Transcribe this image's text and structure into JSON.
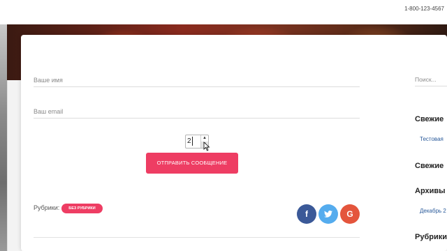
{
  "header": {
    "phone": "1-800-123-4567"
  },
  "form": {
    "name_placeholder": "Ваше имя",
    "email_placeholder": "Ваш email",
    "spinner_value": "2",
    "submit_label": "ОТПРАВИТЬ СООБЩЕНИЕ"
  },
  "post_meta": {
    "categories_label": "Рубрики:",
    "category_badge": "БЕЗ РУБРИКИ"
  },
  "social": {
    "facebook": "f",
    "twitter": "t",
    "google": "G"
  },
  "sidebar": {
    "search_placeholder": "Поиск...",
    "headings": [
      "Свежие",
      "Свежие",
      "Архивы",
      "Рубрики"
    ],
    "links": [
      "Тестовая",
      "Декабрь 2"
    ]
  },
  "colors": {
    "accent": "#ee3d63",
    "facebook": "#3b5998",
    "twitter": "#55acee",
    "google": "#e4553c"
  }
}
